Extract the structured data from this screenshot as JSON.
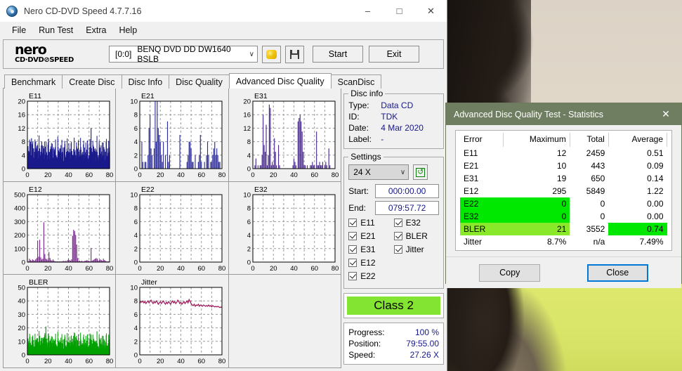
{
  "window": {
    "title": "Nero CD-DVD Speed 4.7.7.16",
    "minimize": "–",
    "maximize": "□",
    "close": "✕"
  },
  "menu": {
    "items": [
      "File",
      "Run Test",
      "Extra",
      "Help"
    ]
  },
  "toolbar": {
    "logo_top": "nero",
    "logo_bottom": "CD·DVD⊘SPEED",
    "drive_id": "[0:0]",
    "drive_name": "BENQ DVD DD DW1640 BSLB",
    "chevron": "∨",
    "eject_icon": "eject-icon",
    "save_icon": "save-floppy-icon",
    "start_label": "Start",
    "exit_label": "Exit"
  },
  "tabs": {
    "items": [
      "Benchmark",
      "Create Disc",
      "Disc Info",
      "Disc Quality",
      "Advanced Disc Quality",
      "ScanDisc"
    ],
    "active": "Advanced Disc Quality"
  },
  "disc_info": {
    "legend": "Disc info",
    "rows": [
      {
        "key": "Type:",
        "value": "Data CD"
      },
      {
        "key": "ID:",
        "value": "TDK"
      },
      {
        "key": "Date:",
        "value": "4 Mar 2020"
      },
      {
        "key": "Label:",
        "value": "-"
      }
    ]
  },
  "settings": {
    "legend": "Settings",
    "speed": "24 X",
    "speed_chevron": "∨",
    "refresh_icon": "refresh-icon",
    "refresh_glyph": "↺",
    "start_label": "Start:",
    "start_value": "000:00.00",
    "end_label": "End:",
    "end_value": "079:57.72",
    "checkboxes": [
      {
        "label": "E11",
        "checked": true
      },
      {
        "label": "E32",
        "checked": true
      },
      {
        "label": "E21",
        "checked": true
      },
      {
        "label": "BLER",
        "checked": true
      },
      {
        "label": "E31",
        "checked": true
      },
      {
        "label": "Jitter",
        "checked": true
      },
      {
        "label": "E12",
        "checked": true
      },
      {
        "label": "",
        "checked": false
      },
      {
        "label": "E22",
        "checked": true
      },
      {
        "label": "",
        "checked": false
      }
    ]
  },
  "quality_class": {
    "label": "Class 2",
    "color": "#84e432"
  },
  "progress": {
    "rows": [
      {
        "key": "Progress:",
        "value": "100 %"
      },
      {
        "key": "Position:",
        "value": "79:55.00"
      },
      {
        "key": "Speed:",
        "value": "27.26 X"
      }
    ]
  },
  "stats_dialog": {
    "title": "Advanced Disc Quality Test - Statistics",
    "close_icon": "✕",
    "headers": [
      "Error",
      "Maximum",
      "Total",
      "Average"
    ],
    "rows": [
      {
        "error": "E11",
        "maximum": "12",
        "total": "2459",
        "average": "0.51",
        "highlight": "none"
      },
      {
        "error": "E21",
        "maximum": "10",
        "total": "443",
        "average": "0.09",
        "highlight": "none"
      },
      {
        "error": "E31",
        "maximum": "19",
        "total": "650",
        "average": "0.14",
        "highlight": "none"
      },
      {
        "error": "E12",
        "maximum": "295",
        "total": "5849",
        "average": "1.22",
        "highlight": "none"
      },
      {
        "error": "E22",
        "maximum": "0",
        "total": "0",
        "average": "0.00",
        "highlight": "green"
      },
      {
        "error": "E32",
        "maximum": "0",
        "total": "0",
        "average": "0.00",
        "highlight": "green"
      },
      {
        "error": "BLER",
        "maximum": "21",
        "total": "3552",
        "average": "0.74",
        "highlight": "bler"
      },
      {
        "error": "Jitter",
        "maximum": "8.7%",
        "total": "n/a",
        "average": "7.49%",
        "highlight": "none"
      }
    ],
    "copy_label": "Copy",
    "close_label": "Close"
  },
  "chart_data": [
    {
      "type": "bar",
      "title": "E11",
      "xlabel": "",
      "ylabel": "",
      "color": "#1a1a8c",
      "fill": true,
      "xlim": [
        0,
        80
      ],
      "ylim": [
        0,
        20
      ],
      "xticks": [
        0,
        20,
        40,
        60,
        80
      ],
      "yticks": [
        0,
        4,
        8,
        12,
        16,
        20
      ],
      "x": [
        1,
        2,
        3,
        4,
        5,
        6,
        7,
        8,
        9,
        10,
        11,
        12,
        13,
        14,
        15,
        16,
        17,
        18,
        19,
        20,
        21,
        22,
        23,
        24,
        25,
        26,
        27,
        28,
        29,
        30,
        31,
        32,
        33,
        34,
        35,
        36,
        37,
        38,
        39,
        40,
        41,
        42,
        43,
        44,
        45,
        46,
        47,
        48,
        49,
        50,
        51,
        52,
        53,
        54,
        55,
        56,
        57,
        58,
        59,
        60,
        61,
        62,
        63,
        64,
        65,
        66,
        67,
        68,
        69,
        70,
        71,
        72,
        73,
        74,
        75,
        76,
        77,
        78,
        79,
        80
      ],
      "values": [
        2,
        5,
        8,
        9,
        7,
        6,
        5,
        8,
        4,
        7,
        3,
        6,
        5,
        8,
        4,
        6,
        3,
        5,
        4,
        7,
        3,
        5,
        4,
        6,
        3,
        5,
        2,
        4,
        3,
        5,
        4,
        6,
        3,
        5,
        2,
        4,
        3,
        5,
        2,
        4,
        1,
        3,
        2,
        4,
        3,
        5,
        4,
        6,
        3,
        5,
        4,
        6,
        3,
        5,
        2,
        4,
        3,
        5,
        2,
        4,
        3,
        12,
        5,
        7,
        4,
        6,
        3,
        5,
        4,
        6,
        3,
        5,
        4,
        6,
        3,
        5,
        4,
        6,
        3,
        5
      ]
    },
    {
      "type": "bar",
      "title": "E21",
      "xlabel": "",
      "ylabel": "",
      "color": "#2b2b9a",
      "fill": false,
      "xlim": [
        0,
        80
      ],
      "ylim": [
        0,
        10
      ],
      "xticks": [
        0,
        20,
        40,
        60,
        80
      ],
      "yticks": [
        0,
        2,
        4,
        6,
        8,
        10
      ],
      "x": [
        1,
        2,
        3,
        4,
        5,
        6,
        7,
        8,
        9,
        10,
        11,
        12,
        13,
        14,
        15,
        16,
        17,
        18,
        19,
        20,
        21,
        22,
        23,
        24,
        25,
        26,
        27,
        28,
        29,
        30,
        31,
        32,
        33,
        34,
        35,
        36,
        37,
        38,
        39,
        40,
        41,
        42,
        43,
        44,
        45,
        46,
        47,
        48,
        49,
        50,
        51,
        52,
        53,
        54,
        55,
        56,
        57,
        58,
        59,
        60,
        61,
        62,
        63,
        64,
        65,
        66,
        67,
        68,
        69,
        70,
        71,
        72,
        73,
        74,
        75,
        76,
        77,
        78,
        79,
        80
      ],
      "values": [
        0,
        4,
        1,
        0,
        1,
        1,
        0,
        2,
        6,
        8,
        3,
        2,
        0,
        3,
        10,
        4,
        10,
        6,
        5,
        4,
        2,
        1,
        4,
        0,
        2,
        0,
        7,
        1,
        2,
        0,
        0,
        0,
        0,
        0,
        0,
        0,
        0,
        0,
        5,
        0,
        0,
        0,
        0,
        0,
        0,
        1,
        2,
        4,
        4,
        3,
        1,
        1,
        0,
        2,
        0,
        0,
        1,
        2,
        5,
        1,
        0,
        0,
        1,
        0,
        2,
        4,
        2,
        0,
        1,
        1,
        2,
        3,
        4,
        2,
        3,
        2,
        1,
        1,
        0,
        0
      ]
    },
    {
      "type": "bar",
      "title": "E31",
      "xlabel": "",
      "ylabel": "",
      "color": "#4a2a8c",
      "fill": false,
      "xlim": [
        0,
        80
      ],
      "ylim": [
        0,
        20
      ],
      "xticks": [
        0,
        20,
        40,
        60,
        80
      ],
      "yticks": [
        0,
        4,
        8,
        12,
        16,
        20
      ],
      "x": [
        1,
        2,
        3,
        4,
        5,
        6,
        7,
        8,
        9,
        10,
        11,
        12,
        13,
        14,
        15,
        16,
        17,
        18,
        19,
        20,
        21,
        22,
        23,
        24,
        25,
        26,
        27,
        28,
        29,
        30,
        31,
        32,
        33,
        34,
        35,
        36,
        37,
        38,
        39,
        40,
        41,
        42,
        43,
        44,
        45,
        46,
        47,
        48,
        49,
        50,
        51,
        52,
        53,
        54,
        55,
        56,
        57,
        58,
        59,
        60,
        61,
        62,
        63,
        64,
        65,
        66,
        67,
        68,
        69,
        70,
        71,
        72,
        73,
        74,
        75,
        76,
        77,
        78,
        79,
        80
      ],
      "values": [
        0,
        1,
        3,
        0,
        1,
        0,
        1,
        1,
        4,
        16,
        7,
        5,
        13,
        1,
        4,
        19,
        18,
        1,
        2,
        1,
        9,
        5,
        1,
        0,
        7,
        1,
        0,
        0,
        0,
        0,
        0,
        0,
        0,
        0,
        0,
        0,
        0,
        0,
        1,
        3,
        2,
        1,
        0,
        14,
        15,
        16,
        14,
        11,
        5,
        1,
        1,
        0,
        1,
        0,
        0,
        1,
        1,
        2,
        1,
        1,
        0,
        11,
        1,
        1,
        2,
        1,
        1,
        2,
        0,
        1,
        2,
        1,
        0,
        6,
        1,
        0,
        0,
        0,
        0,
        0
      ]
    },
    {
      "type": "bar",
      "title": "E12",
      "xlabel": "",
      "ylabel": "",
      "color": "#7b2a8c",
      "fill": false,
      "xlim": [
        0,
        80
      ],
      "ylim": [
        0,
        500
      ],
      "xticks": [
        0,
        20,
        40,
        60,
        80
      ],
      "yticks": [
        0,
        100,
        200,
        300,
        400,
        500
      ],
      "x": [
        1,
        2,
        3,
        4,
        5,
        6,
        7,
        8,
        9,
        10,
        11,
        12,
        13,
        14,
        15,
        16,
        17,
        18,
        19,
        20,
        21,
        22,
        23,
        24,
        25,
        26,
        27,
        28,
        29,
        30,
        31,
        32,
        33,
        34,
        35,
        36,
        37,
        38,
        39,
        40,
        41,
        42,
        43,
        44,
        45,
        46,
        47,
        48,
        49,
        50,
        51,
        52,
        53,
        54,
        55,
        56,
        57,
        58,
        59,
        60,
        61,
        62,
        63,
        64,
        65,
        66,
        67,
        68,
        69,
        70,
        71,
        72,
        73,
        74,
        75,
        76,
        77,
        78,
        79,
        80
      ],
      "values": [
        5,
        25,
        15,
        10,
        20,
        15,
        10,
        20,
        30,
        160,
        40,
        165,
        35,
        20,
        25,
        295,
        60,
        25,
        20,
        15,
        75,
        30,
        15,
        10,
        20,
        10,
        5,
        5,
        5,
        5,
        5,
        5,
        5,
        5,
        10,
        5,
        10,
        5,
        15,
        25,
        15,
        10,
        20,
        195,
        240,
        230,
        200,
        130,
        30,
        10,
        10,
        5,
        10,
        5,
        5,
        10,
        10,
        15,
        10,
        10,
        5,
        105,
        10,
        15,
        20,
        25,
        30,
        25,
        10,
        15,
        20,
        15,
        10,
        25,
        15,
        10,
        5,
        5,
        5,
        5
      ]
    },
    {
      "type": "bar",
      "title": "E22",
      "xlabel": "",
      "ylabel": "",
      "color": "#1a1a8c",
      "fill": false,
      "xlim": [
        0,
        80
      ],
      "ylim": [
        0,
        10
      ],
      "xticks": [
        0,
        20,
        40,
        60,
        80
      ],
      "yticks": [
        0,
        2,
        4,
        6,
        8,
        10
      ],
      "x": [],
      "values": []
    },
    {
      "type": "bar",
      "title": "E32",
      "xlabel": "",
      "ylabel": "",
      "color": "#1a1a8c",
      "fill": false,
      "xlim": [
        0,
        80
      ],
      "ylim": [
        0,
        10
      ],
      "xticks": [
        0,
        20,
        40,
        60,
        80
      ],
      "yticks": [
        0,
        2,
        4,
        6,
        8,
        10
      ],
      "x": [],
      "values": []
    },
    {
      "type": "bar",
      "title": "BLER",
      "xlabel": "",
      "ylabel": "",
      "color": "#00a000",
      "fill": true,
      "xlim": [
        0,
        80
      ],
      "ylim": [
        0,
        50
      ],
      "xticks": [
        0,
        20,
        40,
        60,
        80
      ],
      "yticks": [
        0,
        10,
        20,
        30,
        40,
        50
      ],
      "x": [
        1,
        2,
        3,
        4,
        5,
        6,
        7,
        8,
        9,
        10,
        11,
        12,
        13,
        14,
        15,
        16,
        17,
        18,
        19,
        20,
        21,
        22,
        23,
        24,
        25,
        26,
        27,
        28,
        29,
        30,
        31,
        32,
        33,
        34,
        35,
        36,
        37,
        38,
        39,
        40,
        41,
        42,
        43,
        44,
        45,
        46,
        47,
        48,
        49,
        50,
        51,
        52,
        53,
        54,
        55,
        56,
        57,
        58,
        59,
        60,
        61,
        62,
        63,
        64,
        65,
        66,
        67,
        68,
        69,
        70,
        71,
        72,
        73,
        74,
        75,
        76,
        77,
        78,
        79,
        80
      ],
      "values": [
        3,
        6,
        9,
        7,
        5,
        8,
        6,
        9,
        7,
        12,
        8,
        14,
        10,
        9,
        8,
        13,
        16,
        21,
        12,
        9,
        14,
        10,
        8,
        6,
        9,
        7,
        5,
        8,
        6,
        9,
        5,
        7,
        4,
        6,
        3,
        5,
        4,
        6,
        3,
        5,
        4,
        6,
        5,
        12,
        14,
        16,
        13,
        11,
        7,
        5,
        6,
        4,
        7,
        5,
        4,
        6,
        5,
        9,
        6,
        7,
        5,
        15,
        6,
        8,
        7,
        9,
        6,
        8,
        5,
        7,
        6,
        8,
        5,
        9,
        6,
        7,
        5,
        6,
        4,
        5
      ]
    },
    {
      "type": "line",
      "title": "Jitter",
      "xlabel": "",
      "ylabel": "",
      "color": "#9c1055",
      "fill": false,
      "xlim": [
        0,
        80
      ],
      "ylim": [
        0,
        10
      ],
      "xticks": [
        0,
        20,
        40,
        60,
        80
      ],
      "yticks": [
        0,
        2,
        4,
        6,
        8,
        10
      ],
      "x": [
        0,
        1,
        2,
        3,
        4,
        5,
        6,
        7,
        8,
        9,
        10,
        11,
        12,
        13,
        14,
        15,
        16,
        17,
        18,
        19,
        20,
        21,
        22,
        23,
        24,
        25,
        26,
        27,
        28,
        29,
        30,
        31,
        32,
        33,
        34,
        35,
        36,
        37,
        38,
        39,
        40,
        41,
        42,
        43,
        44,
        45,
        46,
        47,
        48,
        49,
        50,
        51,
        52,
        53,
        54,
        55,
        56,
        57,
        58,
        59,
        60,
        61,
        62,
        63,
        64,
        65,
        66,
        67,
        68,
        69,
        70,
        71,
        72,
        73,
        74,
        75,
        76,
        77,
        78,
        79,
        80
      ],
      "values": [
        7.6,
        7.9,
        7.8,
        8.0,
        7.7,
        7.9,
        7.6,
        7.8,
        8.0,
        7.7,
        7.9,
        8.1,
        7.8,
        7.6,
        7.9,
        7.7,
        8.0,
        7.8,
        7.5,
        7.7,
        7.9,
        7.6,
        7.8,
        8.0,
        7.7,
        7.5,
        7.8,
        7.6,
        7.9,
        7.7,
        7.5,
        7.8,
        8.0,
        7.7,
        7.9,
        7.6,
        7.8,
        8.1,
        7.9,
        7.6,
        7.8,
        7.5,
        7.7,
        7.9,
        7.6,
        7.8,
        8.0,
        7.7,
        8.2,
        7.9,
        7.6,
        7.4,
        7.3,
        7.5,
        7.2,
        7.4,
        7.3,
        7.5,
        7.2,
        7.4,
        7.3,
        7.2,
        7.4,
        7.3,
        7.2,
        7.3,
        7.2,
        7.4,
        7.2,
        7.3,
        7.1,
        7.3,
        7.2,
        7.1,
        7.2,
        7.1,
        7.2,
        7.1,
        7.0,
        7.1,
        7.0
      ]
    }
  ]
}
